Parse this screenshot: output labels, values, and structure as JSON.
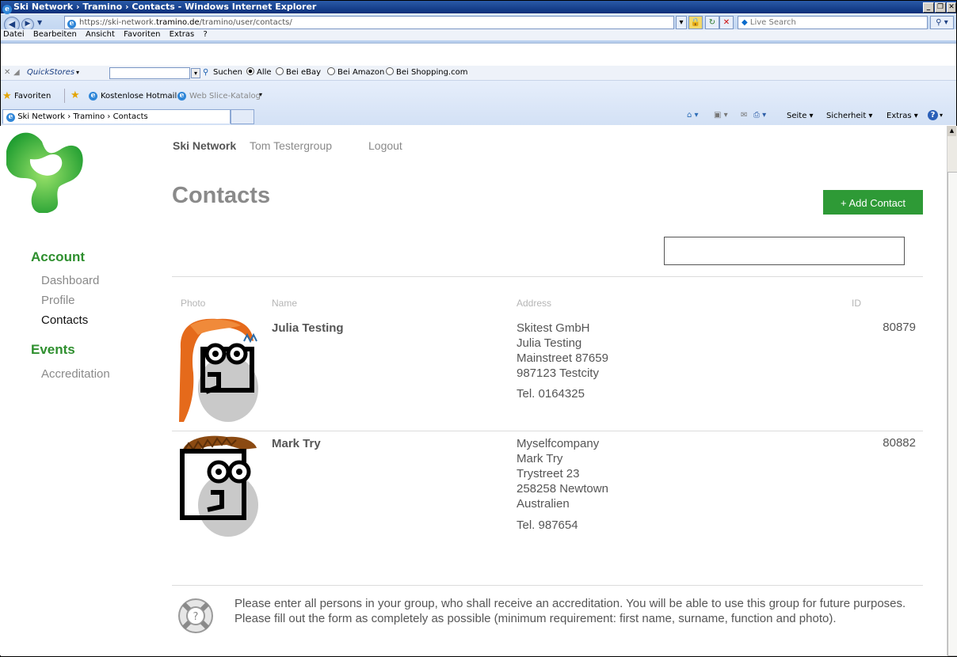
{
  "window": {
    "title": "Ski Network › Tramino › Contacts - Windows Internet Explorer"
  },
  "address_bar": {
    "url_prefix": "https://ski-network.",
    "url_host": "tramino.de",
    "url_path": "/tramino/user/contacts/",
    "search_placeholder": "Live Search"
  },
  "menu": [
    "Datei",
    "Bearbeiten",
    "Ansicht",
    "Favoriten",
    "Extras",
    "?"
  ],
  "quickstores": {
    "label": "QuickStores",
    "search_label": "Suchen",
    "options": [
      "Alle",
      "Bei eBay",
      "Bei Amazon",
      "Bei Shopping.com"
    ],
    "selected": "Alle"
  },
  "favorites_bar": {
    "favorites_label": "Favoriten",
    "items": [
      "Kostenlose Hotmail",
      "Web Slice-Katalog"
    ]
  },
  "tab": {
    "title": "Ski Network › Tramino › Contacts"
  },
  "command_bar": {
    "items": [
      "Seite",
      "Sicherheit",
      "Extras"
    ]
  },
  "site": {
    "nav": {
      "brand": "Ski Network",
      "user": "Tom Testergroup",
      "logout": "Logout"
    },
    "sidebar": {
      "account_heading": "Account",
      "account_items": [
        "Dashboard",
        "Profile",
        "Contacts"
      ],
      "active_item": "Contacts",
      "events_heading": "Events",
      "events_items": [
        "Accreditation"
      ]
    },
    "page_title": "Contacts",
    "add_button": "+ Add Contact",
    "table": {
      "headers": {
        "photo": "Photo",
        "name": "Name",
        "address": "Address",
        "id": "ID"
      },
      "rows": [
        {
          "name": "Julia Testing",
          "address": [
            "Skitest GmbH",
            "Julia Testing",
            "Mainstreet 87659",
            "987123 Testcity"
          ],
          "tel": "Tel. 0164325",
          "id": "80879",
          "hair": "orange"
        },
        {
          "name": "Mark Try",
          "address": [
            "Myselfcompany",
            "Mark Try",
            "Trystreet 23",
            "258258 Newtown",
            "Australien"
          ],
          "tel": "Tel. 987654",
          "id": "80882",
          "hair": "brown"
        }
      ]
    },
    "info": {
      "line1": "Please enter all persons in your group, who shall receive an accreditation. You will be able to use this group for future purposes.",
      "line2": "Please fill out the form as completely as possible (minimum requirement: first name, surname, function and photo)."
    },
    "accent_color": "#2e9a36"
  }
}
